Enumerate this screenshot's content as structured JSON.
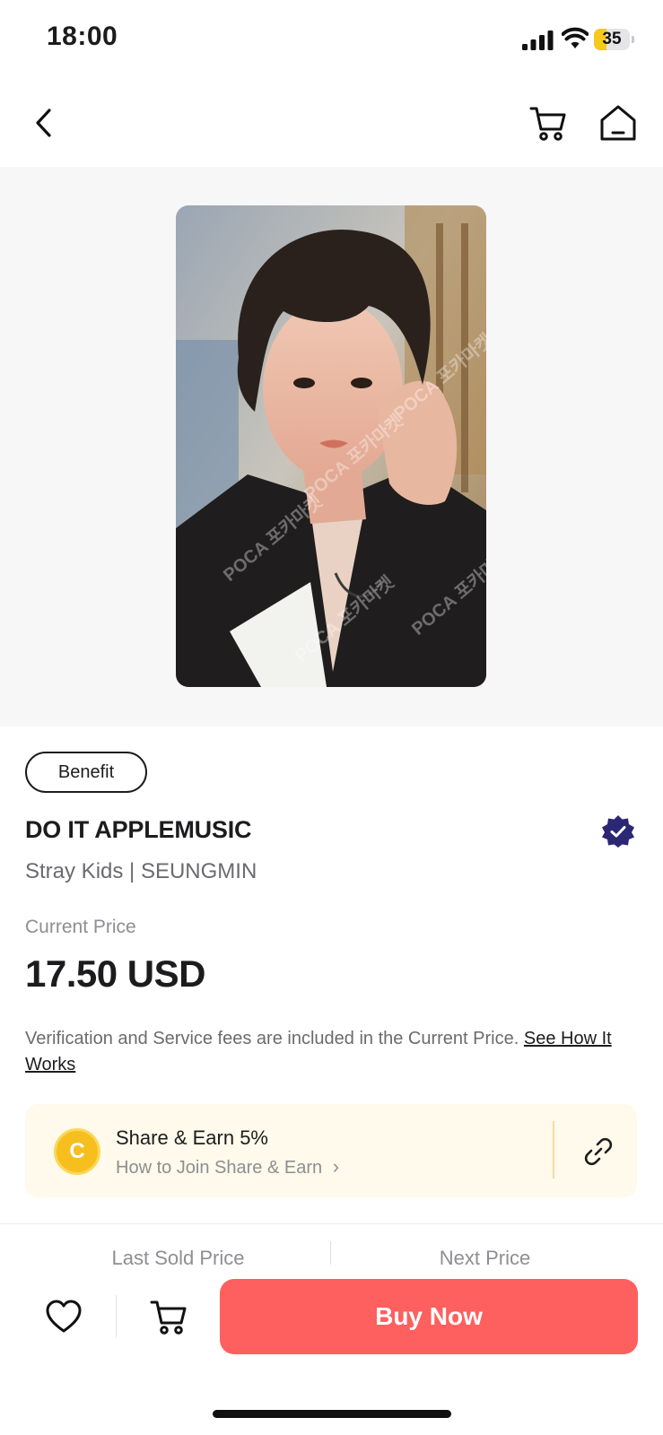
{
  "status_bar": {
    "time": "18:00",
    "battery_level": "35",
    "battery_fraction": 0.35
  },
  "nav": {
    "back_icon": "chevron-left-icon",
    "cart_icon": "cart-icon",
    "home_icon": "home-icon"
  },
  "product": {
    "benefit_label": "Benefit",
    "title": "DO IT APPLEMUSIC",
    "artist": "Stray Kids | SEUNGMIN",
    "price_label": "Current Price",
    "price": "17.50 USD",
    "fee_note": "Verification and Service fees are included in the Current Price.",
    "fee_link": "See How It Works",
    "watermark": "POCA 포카마켓"
  },
  "share": {
    "coin_letter": "C",
    "title": "Share & Earn 5%",
    "subtitle": "How to Join Share & Earn",
    "chevron": "›"
  },
  "price_strip": {
    "last_sold_label": "Last Sold Price",
    "next_price_label": "Next Price"
  },
  "bottom_bar": {
    "buy_label": "Buy Now"
  },
  "colors": {
    "accent": "#fe5f5f",
    "coin": "#f6bf1e",
    "verified": "#2b2774",
    "share_bg": "#fffaeb"
  }
}
